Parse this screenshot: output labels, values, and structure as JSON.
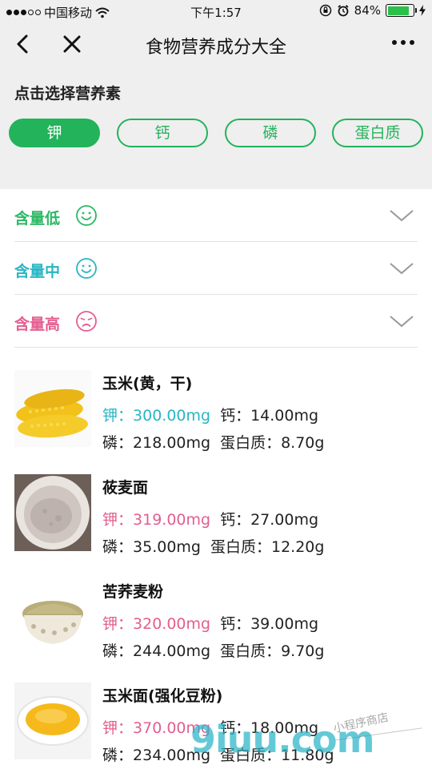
{
  "status_bar": {
    "carrier": "中国移动",
    "time": "下午1:57",
    "battery": "84%",
    "battery_level": 0.84
  },
  "nav": {
    "title": "食物营养成分大全"
  },
  "selector": {
    "label": "点击选择营养素",
    "chips": [
      "钾",
      "钙",
      "磷",
      "蛋白质"
    ],
    "active_index": 0
  },
  "levels": [
    {
      "label": "含量低",
      "face": "smile",
      "color": "#2bb964"
    },
    {
      "label": "含量中",
      "face": "smile",
      "color": "#27b6c4"
    },
    {
      "label": "含量高",
      "face": "sad",
      "color": "#e35e8f"
    }
  ],
  "foods": [
    {
      "name": "玉米(黄，干)",
      "k_label": "钾：",
      "k": "300.00mg",
      "ca_label": "钙：",
      "ca": "14.00mg",
      "p_label": "磷：",
      "p": "218.00mg",
      "pr_label": "蛋白质：",
      "pr": "8.70g",
      "k_level": "mid",
      "image": "corn-photo"
    },
    {
      "name": "莜麦面",
      "k_label": "钾：",
      "k": "319.00mg",
      "ca_label": "钙：",
      "ca": "27.00mg",
      "p_label": "磷：",
      "p": "35.00mg",
      "pr_label": "蛋白质：",
      "pr": "12.20g",
      "k_level": "high",
      "image": "oat-flour-photo"
    },
    {
      "name": "苦荞麦粉",
      "k_label": "钾：",
      "k": "320.00mg",
      "ca_label": "钙：",
      "ca": "39.00mg",
      "p_label": "磷：",
      "p": "244.00mg",
      "pr_label": "蛋白质：",
      "pr": "9.70g",
      "k_level": "high",
      "image": "buckwheat-flour-photo"
    },
    {
      "name": "玉米面(强化豆粉)",
      "k_label": "钾：",
      "k": "370.00mg",
      "ca_label": "钙：",
      "ca": "18.00mg",
      "p_label": "磷：",
      "p": "234.00mg",
      "pr_label": "蛋白质：",
      "pr": "11.80g",
      "k_level": "high",
      "image": "cornmeal-photo"
    }
  ],
  "watermark": {
    "main": "9iuu.com",
    "sub": "小程序商店"
  },
  "colors": {
    "accent_green": "#23b35b",
    "mid_teal": "#27b6c4",
    "high_pink": "#e35e8f"
  }
}
